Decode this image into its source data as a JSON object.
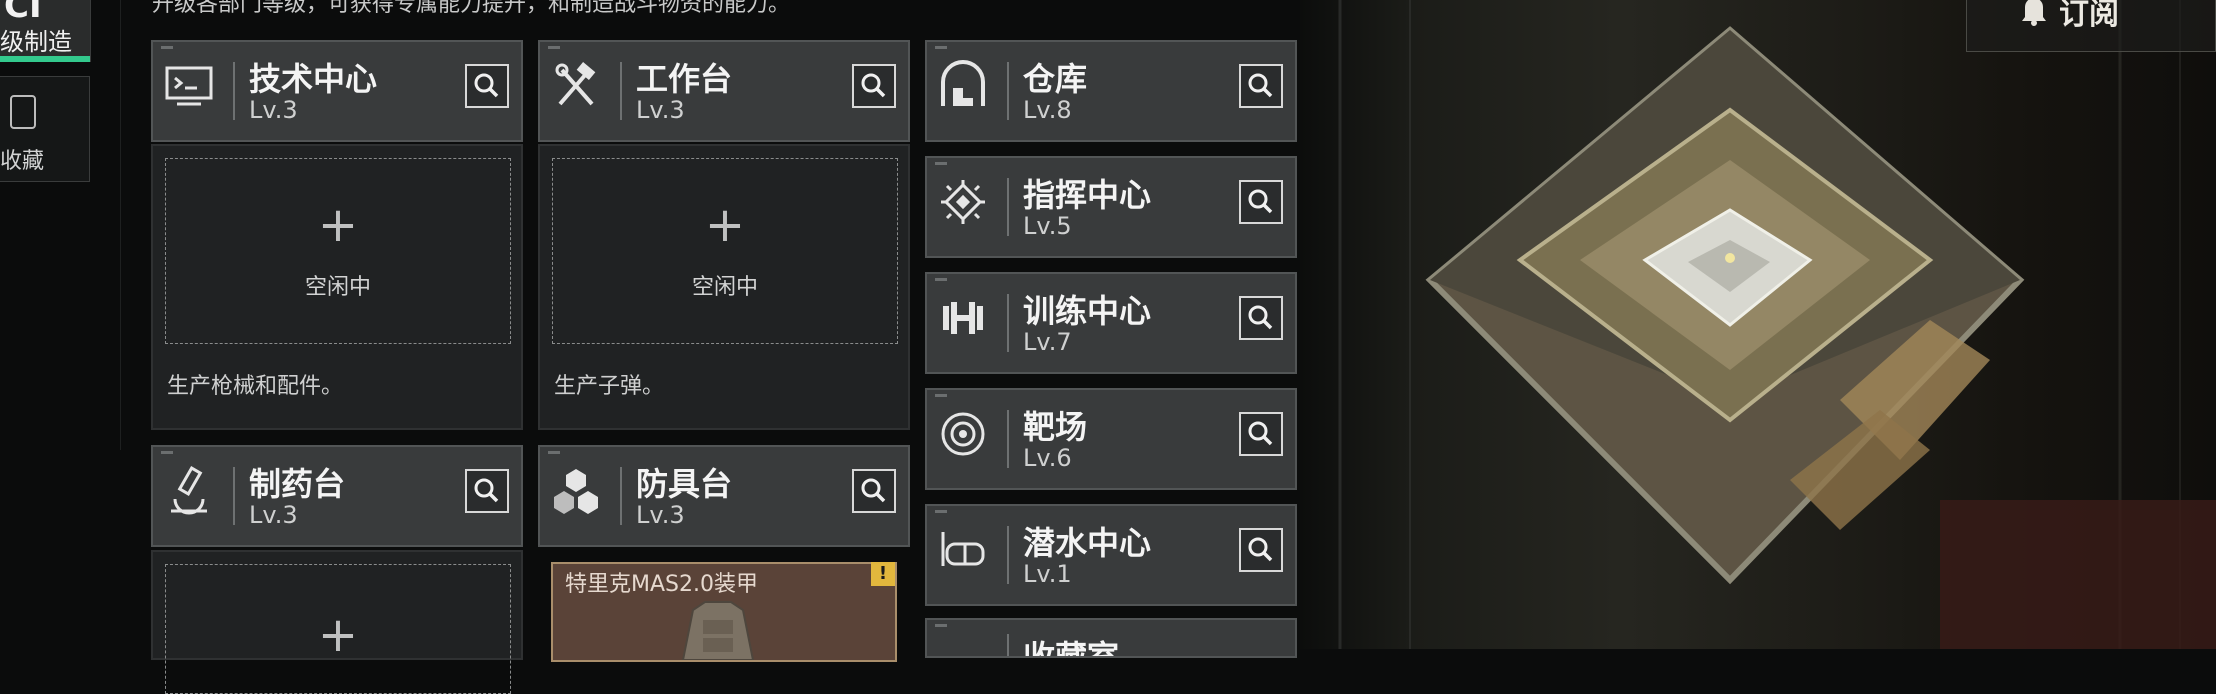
{
  "sidebar": {
    "tab1_glyph": "CI",
    "tab1_label": "级制造",
    "tab2_label": "收藏"
  },
  "description": "升级各部门等级，可获得专属能力提升，和制造战斗物资的能力。",
  "facilities_left": [
    {
      "name": "技术中心",
      "level": "Lv.3",
      "icon": "terminal-icon",
      "status": "空闲中",
      "note": "生产枪械和配件。"
    },
    {
      "name": "工作台",
      "level": "Lv.3",
      "icon": "tools-icon",
      "status": "空闲中",
      "note": "生产子弹。"
    },
    {
      "name": "制药台",
      "level": "Lv.3",
      "icon": "microscope-icon"
    },
    {
      "name": "防具台",
      "level": "Lv.3",
      "icon": "cubes-icon",
      "item": "特里克MAS2.0装甲",
      "item_badge": "!"
    }
  ],
  "facilities_right": [
    {
      "name": "仓库",
      "level": "Lv.8",
      "icon": "warehouse-icon"
    },
    {
      "name": "指挥中心",
      "level": "Lv.5",
      "icon": "chip-icon"
    },
    {
      "name": "训练中心",
      "level": "Lv.7",
      "icon": "dumbbell-icon"
    },
    {
      "name": "靶场",
      "level": "Lv.6",
      "icon": "target-icon"
    },
    {
      "name": "潜水中心",
      "level": "Lv.1",
      "icon": "diving-mask-icon"
    },
    {
      "name": "收藏室",
      "level": "",
      "icon": "collection-icon"
    }
  ],
  "header": {
    "subscribe_label": "订阅"
  },
  "colors": {
    "accent": "#33c98d",
    "card_bg": "#393b3c",
    "warning": "#e2b73d"
  }
}
